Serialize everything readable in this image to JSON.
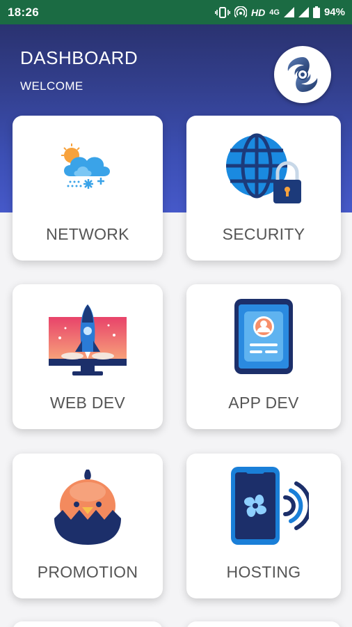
{
  "status_bar": {
    "time": "18:26",
    "hd": "HD",
    "network": "4G",
    "battery": "94%"
  },
  "header": {
    "title": "DASHBOARD",
    "subtitle": "WELCOME"
  },
  "cards": [
    {
      "label": "NETWORK",
      "icon": "weather-cloud-icon"
    },
    {
      "label": "SECURITY",
      "icon": "globe-lock-icon"
    },
    {
      "label": "WEB DEV",
      "icon": "monitor-rocket-icon"
    },
    {
      "label": "APP DEV",
      "icon": "phone-profile-icon"
    },
    {
      "label": "PROMOTION",
      "icon": "chick-egg-icon"
    },
    {
      "label": "HOSTING",
      "icon": "phone-fan-icon"
    }
  ],
  "colors": {
    "status_bar": "#1b6b43",
    "header_top": "#2a3270",
    "header_bottom": "#4659c9",
    "card_text": "#555555"
  }
}
